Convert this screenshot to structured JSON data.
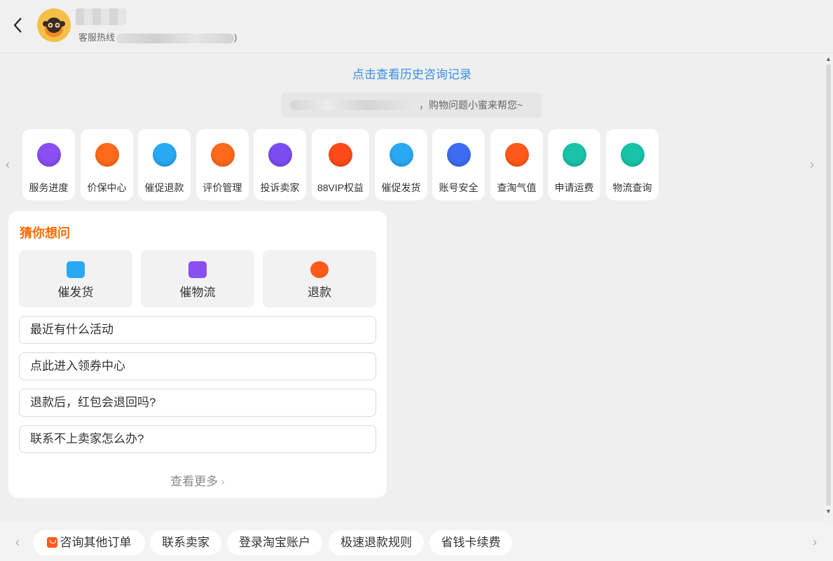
{
  "header": {
    "subtitle_prefix": "客服热线",
    "subtitle_suffix": ")"
  },
  "chat": {
    "history_link": "点击查看历史咨询记录",
    "welcome_suffix": "，购物问题小蜜来帮您~"
  },
  "services": [
    {
      "label": "服务进度",
      "icon": "service-progress-icon",
      "color": "#8a4ff0"
    },
    {
      "label": "价保中心",
      "icon": "price-protect-icon",
      "color": "#ff6a1a"
    },
    {
      "label": "催促退款",
      "icon": "urge-refund-icon",
      "color": "#2aa9f3"
    },
    {
      "label": "评价管理",
      "icon": "review-manage-icon",
      "color": "#ff6a1a"
    },
    {
      "label": "投诉卖家",
      "icon": "complain-seller-icon",
      "color": "#7b4df0"
    },
    {
      "label": "88VIP权益",
      "icon": "vip-icon",
      "color": "#ff4a1a"
    },
    {
      "label": "催促发货",
      "icon": "urge-shipping-icon",
      "color": "#2aa9f3"
    },
    {
      "label": "账号安全",
      "icon": "account-security-icon",
      "color": "#3d6cf2"
    },
    {
      "label": "查淘气值",
      "icon": "taoqi-value-icon",
      "color": "#ff5a1a"
    },
    {
      "label": "申请运费",
      "icon": "apply-freight-icon",
      "color": "#19c3a8"
    },
    {
      "label": "物流查询",
      "icon": "logistics-query-icon",
      "color": "#19c3a8"
    }
  ],
  "guess": {
    "title": "猜你想问",
    "quick": [
      {
        "label": "催发货",
        "icon": "shipping-box-icon",
        "color": "#2aa9f3"
      },
      {
        "label": "催物流",
        "icon": "truck-icon",
        "color": "#8a4ff0"
      },
      {
        "label": "退款",
        "icon": "refund-icon",
        "color": "#ff5a1a"
      }
    ],
    "faqs": [
      "最近有什么活动",
      "点此进入领券中心",
      "退款后，红包会退回吗?",
      "联系不上卖家怎么办?"
    ],
    "more": "查看更多"
  },
  "bottom": {
    "chips": [
      "咨询其他订单",
      "联系卖家",
      "登录淘宝账户",
      "极速退款规则",
      "省钱卡续费"
    ]
  },
  "colors": {
    "accent": "#ff6a00",
    "link": "#3a8ee6"
  }
}
